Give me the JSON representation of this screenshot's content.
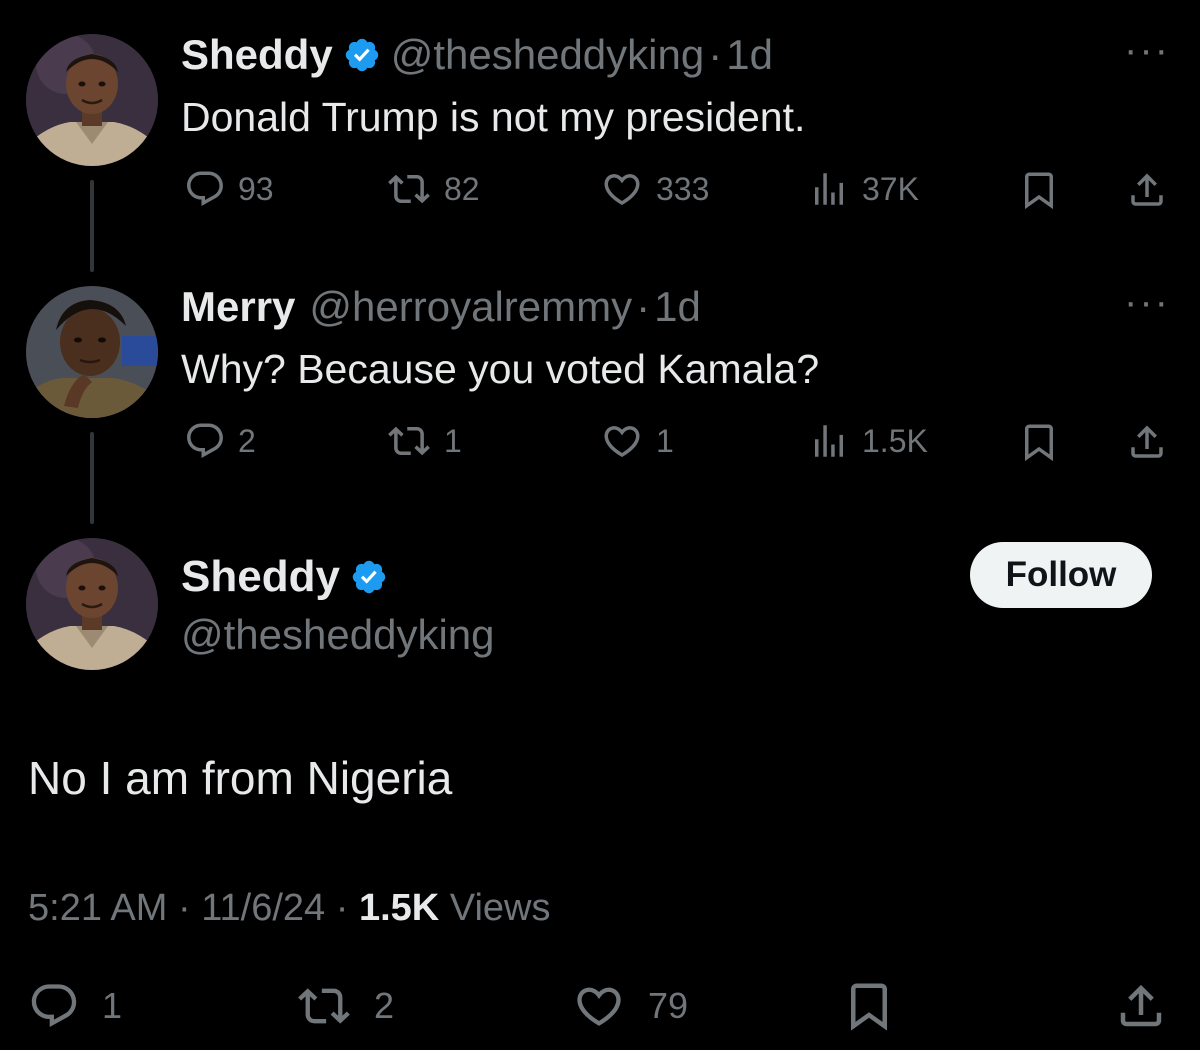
{
  "colors": {
    "background": "#000000",
    "text": "#e7e9ea",
    "muted": "#71767b",
    "verified": "#1d9bf0",
    "follow_bg": "#eff3f4"
  },
  "tweet1": {
    "name": "Sheddy",
    "handle": "@thesheddyking",
    "dot": "·",
    "time": "1d",
    "text": "Donald Trump is not my president.",
    "more": "···",
    "replies": "93",
    "reposts": "82",
    "likes": "333",
    "views": "37K"
  },
  "tweet2": {
    "name": "Merry",
    "handle": "@herroyalremmy",
    "dot": "·",
    "time": "1d",
    "text": "Why? Because you voted Kamala?",
    "more": "···",
    "replies": "2",
    "reposts": "1",
    "likes": "1",
    "views": "1.5K"
  },
  "main_tweet": {
    "name": "Sheddy",
    "handle": "@thesheddyking",
    "follow_label": "Follow",
    "text": "No I am from Nigeria",
    "time": "5:21 AM",
    "dot": "·",
    "date": "11/6/24",
    "views_count": "1.5K",
    "views_label": "Views",
    "replies": "1",
    "reposts": "2",
    "likes": "79"
  },
  "icons": {
    "reply": "reply-icon",
    "repost": "repost-icon",
    "like": "heart-icon",
    "views": "views-icon",
    "bookmark": "bookmark-icon",
    "share": "share-icon",
    "verified": "verified-badge-icon",
    "more": "more-icon"
  }
}
